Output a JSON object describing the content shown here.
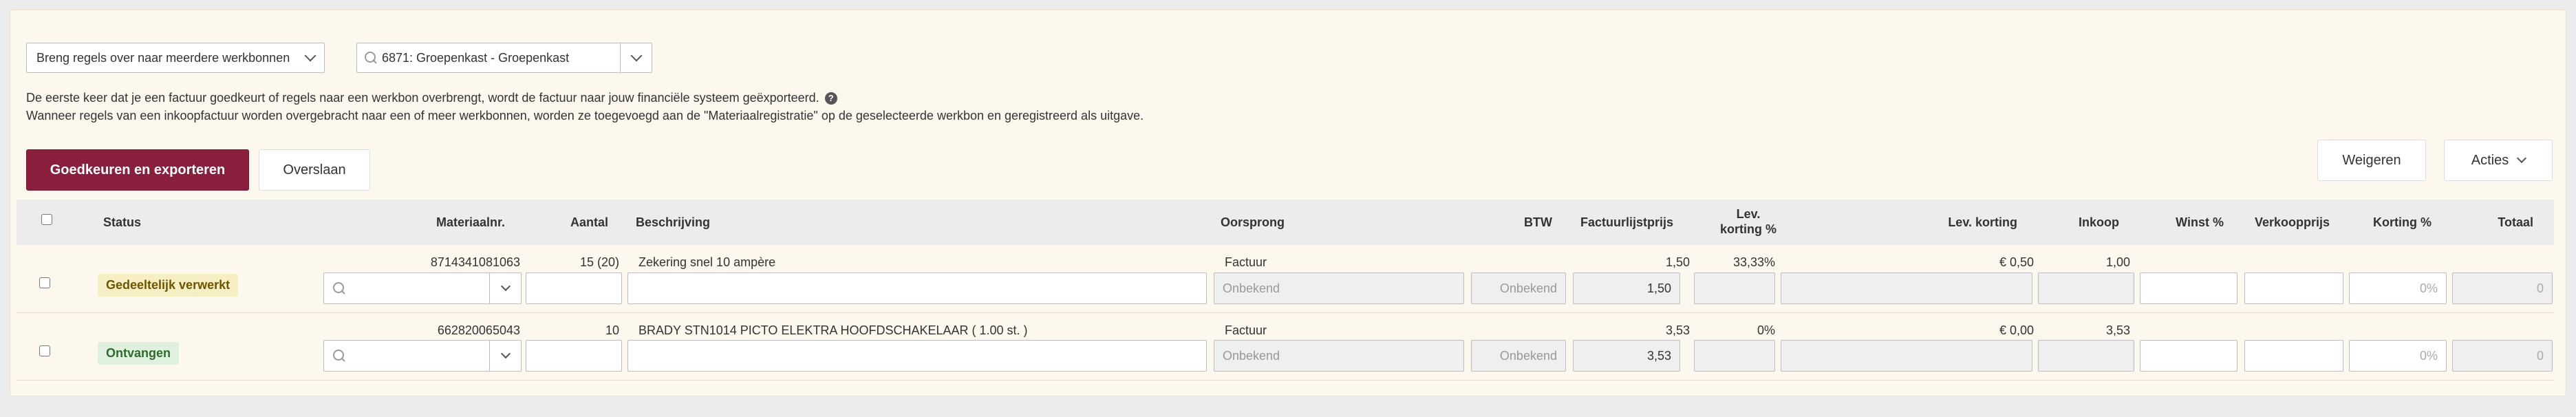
{
  "toolbar": {
    "move_rules_select": "Breng regels over naar meerdere werkbonnen",
    "workorder_search_value": "6871: Groepenkast - Groepenkast"
  },
  "info": {
    "line1": "De eerste keer dat je een factuur goedkeurt of regels naar een werkbon overbrengt, wordt de factuur naar jouw financiële systeem geëxporteerd.",
    "line2": "Wanneer regels van een inkoopfactuur worden overgebracht naar een of meer werkbonnen, worden ze toegevoegd aan de \"Materiaalregistratie\" op de geselecteerde werkbon en geregistreerd als uitgave.",
    "help_glyph": "?"
  },
  "actions": {
    "approve_export": "Goedkeuren en exporteren",
    "skip": "Overslaan",
    "reject": "Weigeren",
    "more_actions": "Acties"
  },
  "table": {
    "headers": {
      "status": "Status",
      "material_nr": "Materiaalnr.",
      "quantity": "Aantal",
      "description": "Beschrijving",
      "origin": "Oorsprong",
      "vat": "BTW",
      "invoice_list_price": "Factuurlijstprijs",
      "supplier_discount_pct_1": "Lev.",
      "supplier_discount_pct_2": "korting %",
      "supplier_discount": "Lev. korting",
      "purchase": "Inkoop",
      "profit_pct": "Winst %",
      "sale_price": "Verkoopprijs",
      "discount_pct": "Korting %",
      "total": "Totaal"
    },
    "rows": [
      {
        "status": "Gedeeltelijk verwerkt",
        "status_kind": "partial",
        "material_nr": "8714341081063",
        "quantity": "15 (20)",
        "description": "Zekering snel 10 ampère",
        "origin": "Factuur",
        "invoice_list_price": "1,50",
        "supplier_discount_pct": "33,33%",
        "supplier_discount": "€ 0,50",
        "purchase": "1,00",
        "origin_placeholder": "Onbekend",
        "vat_placeholder": "Onbekend",
        "list_price_input": "1,50",
        "discount_pct_placeholder": "0%",
        "total_placeholder": "0"
      },
      {
        "status": "Ontvangen",
        "status_kind": "received",
        "material_nr": "662820065043",
        "quantity": "10",
        "description": "BRADY STN1014 PICTO ELEKTRA HOOFDSCHAKELAAR ( 1.00 st. )",
        "origin": "Factuur",
        "invoice_list_price": "3,53",
        "supplier_discount_pct": "0%",
        "supplier_discount": "€ 0,00",
        "purchase": "3,53",
        "origin_placeholder": "Onbekend",
        "vat_placeholder": "Onbekend",
        "list_price_input": "3,53",
        "discount_pct_placeholder": "0%",
        "total_placeholder": "0"
      }
    ]
  },
  "colors": {
    "primary_button": "#8a1e3d",
    "panel_background": "#fcf8ee",
    "badge_partial": "#f7efc4",
    "badge_received": "#dff1de"
  },
  "icons": [
    "chevron-down-icon",
    "search-icon",
    "help-icon"
  ]
}
